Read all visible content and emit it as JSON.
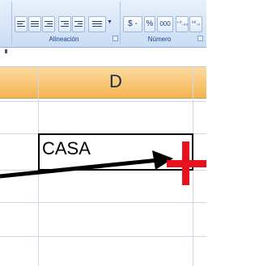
{
  "ribbon": {
    "groups": {
      "alignment": {
        "label": "Alineación"
      },
      "number": {
        "label": "Número"
      }
    },
    "number_buttons": {
      "currency": "$ -",
      "percent": "%",
      "thousands": "000",
      "increase_decimal": "⁺⁰.₀₀",
      "decrease_decimal": "⁰⁰.₀"
    }
  },
  "sheet": {
    "column_header": "D",
    "active_cell_value": "CASA"
  },
  "annotation": {
    "arrow_color": "#000000",
    "fill_handle_marker_color": "#e8121e"
  }
}
